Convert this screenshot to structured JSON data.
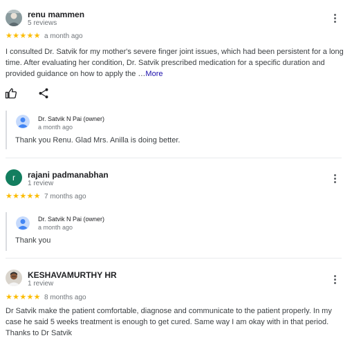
{
  "reviews": [
    {
      "reviewer_name": "renu mammen",
      "reviewer_count": "5 reviews",
      "stars": "★★★★★",
      "time": "a month ago",
      "text": "I consulted Dr. Satvik for my mother's severe finger joint issues, which had been persistent for a long time. After evaluating her condition, Dr. Satvik prescribed medication for a specific duration and provided guidance on how to apply the …",
      "more_label": "More",
      "reply": {
        "owner_name": "Dr. Satvik N Pai (owner)",
        "time": "a month ago",
        "text": "Thank you Renu. Glad Mrs. Anilla is doing better."
      }
    },
    {
      "reviewer_name": "rajani padmanabhan",
      "reviewer_count": "1 review",
      "avatar_letter": "r",
      "stars": "★★★★★",
      "time": "7 months ago",
      "reply": {
        "owner_name": "Dr. Satvik N Pai (owner)",
        "time": "a month ago",
        "text": "Thank you"
      }
    },
    {
      "reviewer_name": "KESHAVAMURTHY HR",
      "reviewer_count": "1 review",
      "stars": "★★★★★",
      "time": "8 months ago",
      "text": "Dr Satvik make the patient comfortable, diagnose and communicate to the patient properly. In my case he said 5 weeks treatment is enough to get cured. Same way I am okay with in that period. Thanks to Dr Satvik"
    }
  ],
  "icons": {
    "like": "thumbs-up-icon",
    "share": "share-icon",
    "more": "more-vertical-icon",
    "owner_avatar": "person-icon"
  },
  "colors": {
    "star": "#fbbc04",
    "link": "#1a0dab",
    "avatar_green": "#137e5f",
    "owner_avatar_bg": "#c6dafc",
    "owner_avatar_fg": "#4285f4"
  }
}
